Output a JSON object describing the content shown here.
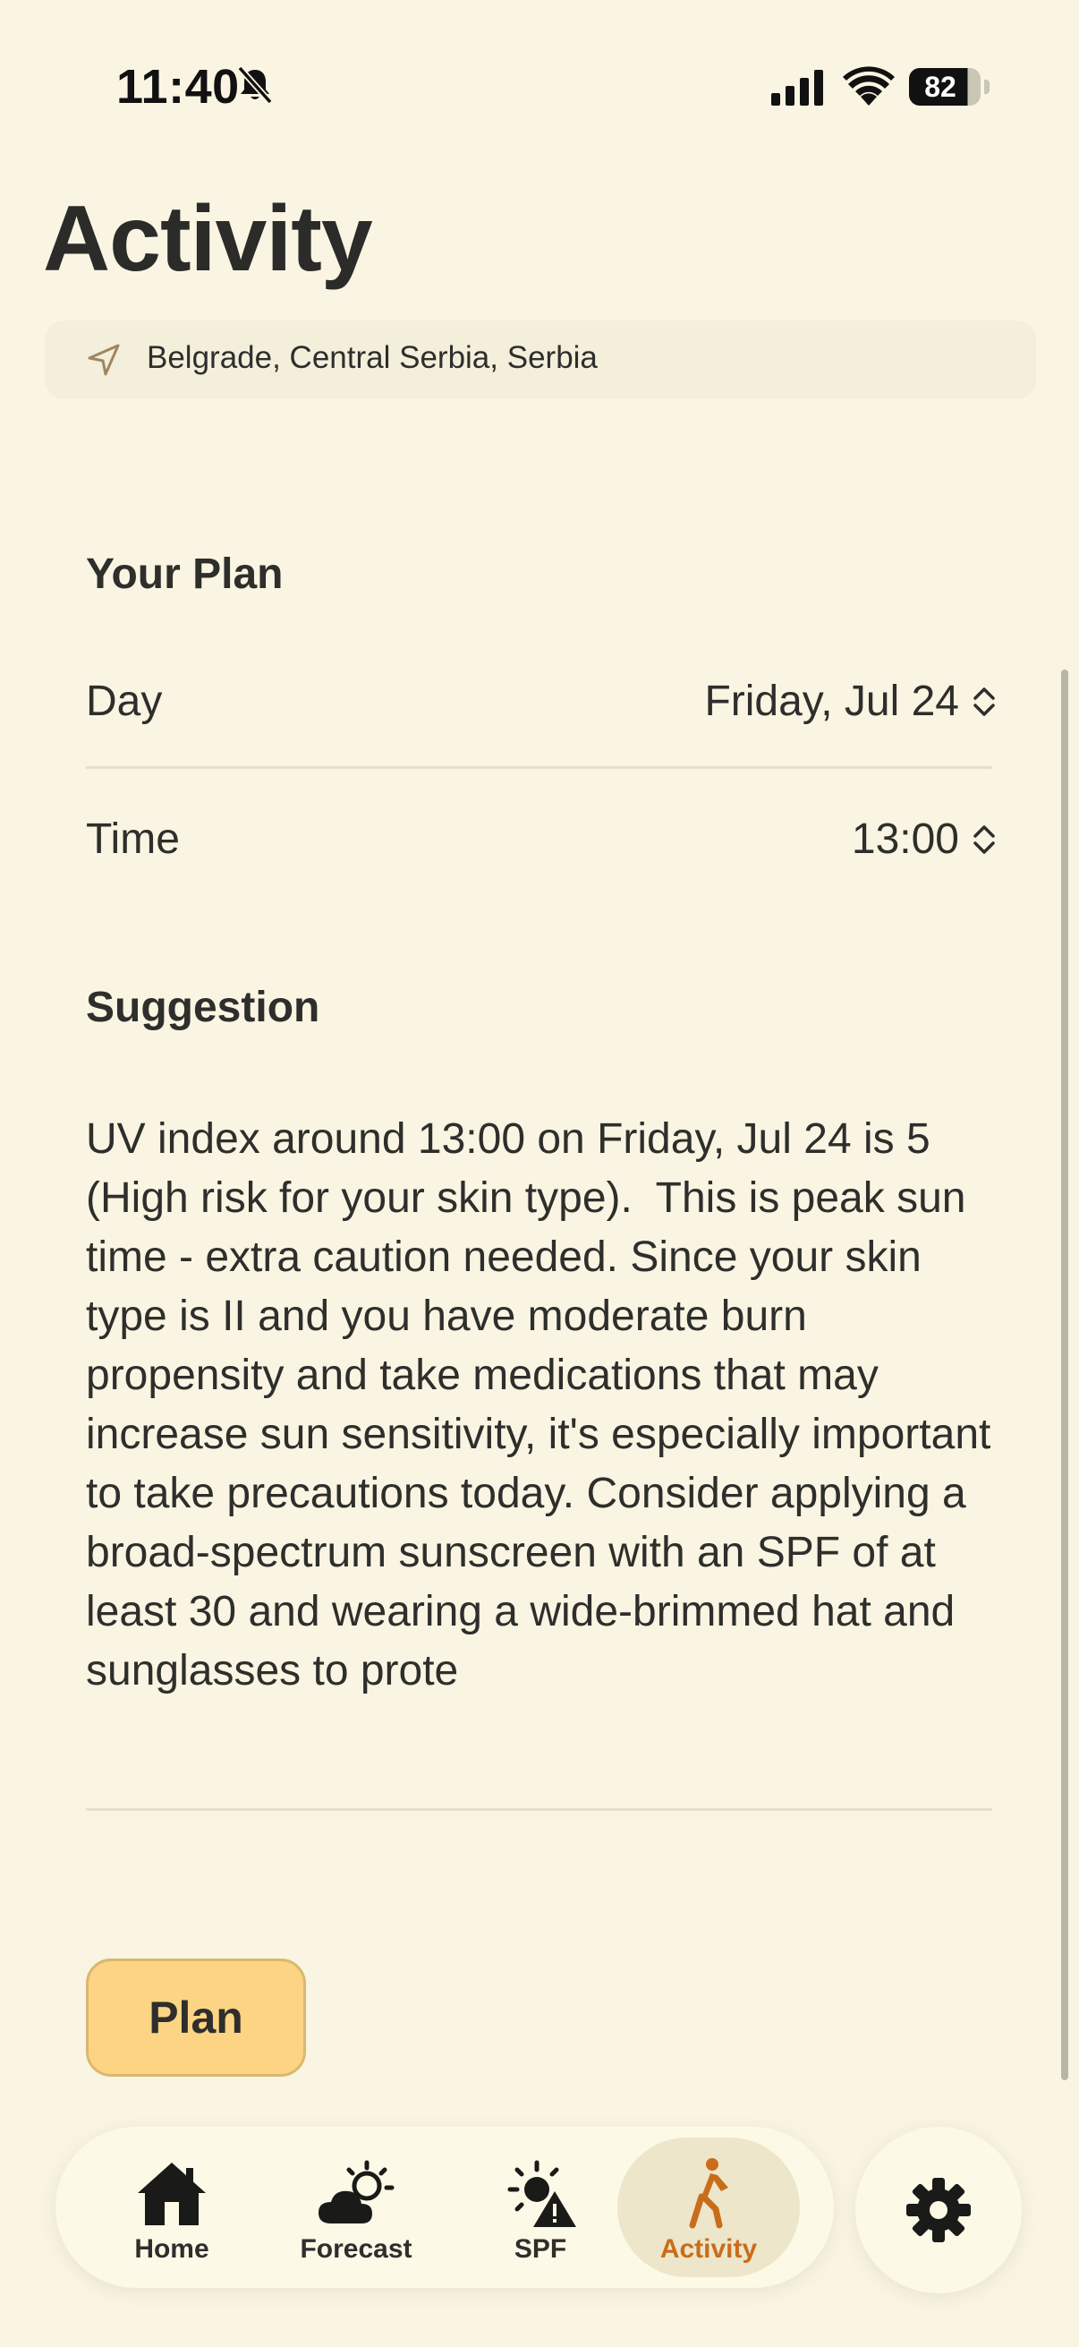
{
  "status_bar": {
    "time": "11:40",
    "battery": "82"
  },
  "header": {
    "title": "Activity",
    "location": "Belgrade, Central Serbia, Serbia"
  },
  "plan": {
    "section_title": "Your Plan",
    "day_label": "Day",
    "day_value": "Friday, Jul 24",
    "time_label": "Time",
    "time_value": "13:00"
  },
  "suggestion": {
    "section_title": "Suggestion",
    "text": "UV index around 13:00 on Friday, Jul 24 is 5 (High risk for your skin type).  This is peak sun time - extra caution needed. Since your skin type is II and you have moderate burn propensity and take medications that may increase sun sensitivity, it's especially important to take precautions today. Consider applying a broad-spectrum sunscreen with an SPF of at least 30 and wearing a wide-brimmed hat and sunglasses to prote"
  },
  "plan_button_label": "Plan",
  "tabs": [
    {
      "label": "Home",
      "icon": "house-icon"
    },
    {
      "label": "Forecast",
      "icon": "cloud-sun-icon"
    },
    {
      "label": "SPF",
      "icon": "sun-warning-icon"
    },
    {
      "label": "Activity",
      "icon": "walking-icon",
      "active": true
    }
  ],
  "settings_icon": "gear-icon",
  "colors": {
    "background": "#f9f5e2",
    "accent": "#c96d1a",
    "plan_button": "#fdd483",
    "active_tab": "#ede6cb"
  }
}
